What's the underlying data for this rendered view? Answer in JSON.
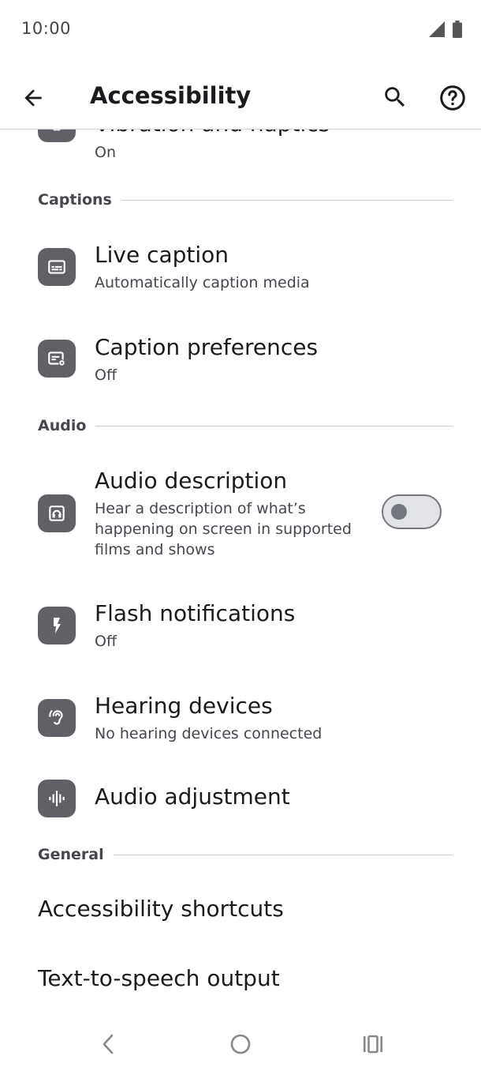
{
  "status_bar": {
    "time": "10:00"
  },
  "app_bar": {
    "title": "Accessibility"
  },
  "partial_item": {
    "title": "Vibration and haptics",
    "subtitle": "On"
  },
  "sections": {
    "captions": "Captions",
    "audio": "Audio",
    "general": "General"
  },
  "items": {
    "live_caption": {
      "title": "Live caption",
      "subtitle": "Automatically caption media"
    },
    "caption_preferences": {
      "title": "Caption preferences",
      "subtitle": "Off"
    },
    "audio_description": {
      "title": "Audio description",
      "subtitle": "Hear a description of what’s happening on screen in supported films and shows",
      "toggle_on": false
    },
    "flash_notifications": {
      "title": "Flash notifications",
      "subtitle": "Off"
    },
    "hearing_devices": {
      "title": "Hearing devices",
      "subtitle": "No hearing devices connected"
    },
    "audio_adjustment": {
      "title": "Audio adjustment"
    },
    "accessibility_shortcuts": {
      "title": "Accessibility shortcuts"
    },
    "text_to_speech": {
      "title": "Text-to-speech output"
    }
  },
  "colors": {
    "icon_bg": "#5f6166",
    "divider": "#cfcfcf",
    "text_primary": "#1b1b1f",
    "text_secondary": "#46464f"
  }
}
